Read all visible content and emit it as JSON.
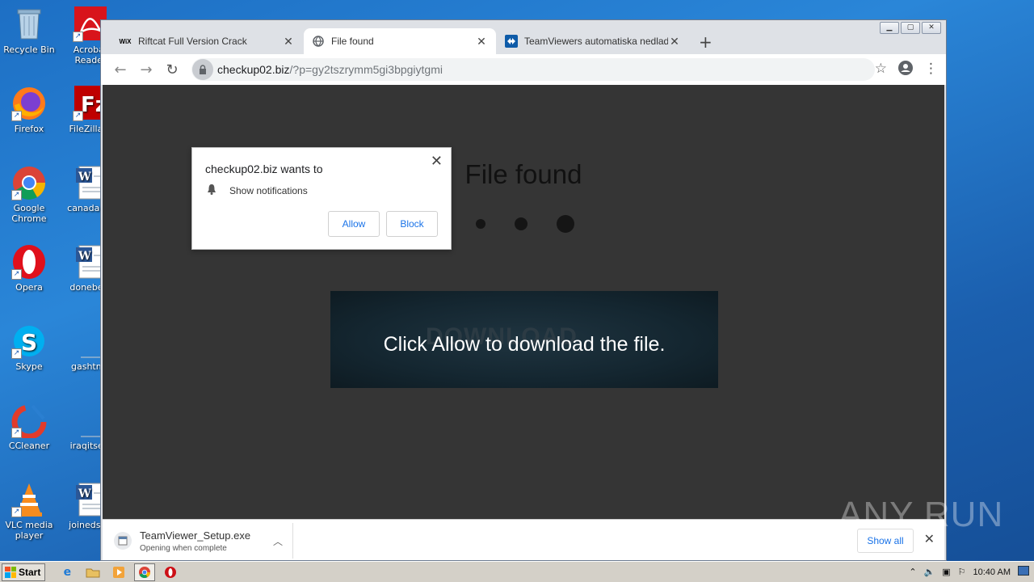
{
  "desktop": {
    "icons": [
      {
        "label": "Recycle Bin"
      },
      {
        "label": "Acrobat Reader"
      },
      {
        "label": "Firefox"
      },
      {
        "label": "FileZilla C"
      },
      {
        "label": "Google Chrome"
      },
      {
        "label": "canadame"
      },
      {
        "label": "Opera"
      },
      {
        "label": "donebest"
      },
      {
        "label": "Skype"
      },
      {
        "label": "gashtml."
      },
      {
        "label": "CCleaner"
      },
      {
        "label": "iraqitself."
      },
      {
        "label": "VLC media player"
      },
      {
        "label": "joinedsuit"
      }
    ]
  },
  "browser": {
    "tabs": [
      {
        "title": "Riftcat Full Version Crack",
        "favicon": "WiX"
      },
      {
        "title": "File found",
        "favicon": "globe-icon"
      },
      {
        "title": "TeamViewers automatiska nedladdning",
        "favicon": "teamviewer-icon"
      }
    ],
    "url_host": "checkup02.biz",
    "url_path": "/?p=gy2tszrymm5gi3bpgiytgmi",
    "window_controls": [
      "minimize",
      "restore",
      "close"
    ]
  },
  "page": {
    "title": "File found",
    "download_ghost": "DOWNLOAD",
    "download_message": "Click Allow to download the file.",
    "bg_color": "#353535"
  },
  "notification_popup": {
    "title": "checkup02.biz wants to",
    "permission": "Show notifications",
    "allow_label": "Allow",
    "block_label": "Block"
  },
  "download_bar": {
    "filename": "TeamViewer_Setup.exe",
    "status": "Opening when complete",
    "show_all_label": "Show all"
  },
  "watermark": "ANY RUN",
  "taskbar": {
    "start_label": "Start",
    "clock": "10:40 AM"
  }
}
